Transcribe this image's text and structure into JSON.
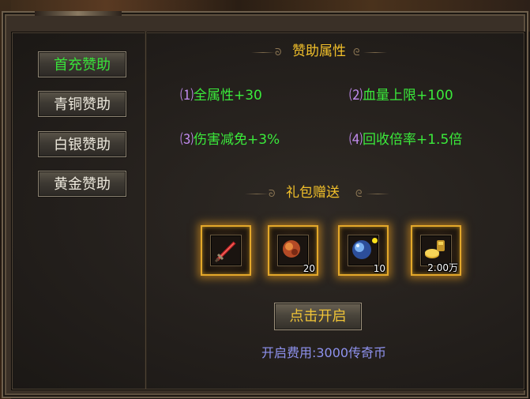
{
  "tabs": [
    {
      "label": "首充赞助",
      "active": true
    },
    {
      "label": "青铜赞助",
      "active": false
    },
    {
      "label": "白银赞助",
      "active": false
    },
    {
      "label": "黄金赞助",
      "active": false
    }
  ],
  "attributes_section": {
    "title": "赞助属性",
    "items": [
      {
        "index": "⑴",
        "text": "全属性+30"
      },
      {
        "index": "⑵",
        "text": "血量上限+100"
      },
      {
        "index": "⑶",
        "text": "伤害减免+3%"
      },
      {
        "index": "⑷",
        "text": "回收倍率+1.5倍"
      }
    ]
  },
  "gift_section": {
    "title": "礼包赠送",
    "items": [
      {
        "icon": "red-sword-icon",
        "count": ""
      },
      {
        "icon": "red-gem-icon",
        "count": "20"
      },
      {
        "icon": "blue-orb-icon",
        "count": "10"
      },
      {
        "icon": "gold-coins-icon",
        "count": "2.00万"
      }
    ]
  },
  "open_button": {
    "label": "点击开启"
  },
  "cost_text": "开启费用:3000传奇币",
  "colors": {
    "active_tab": "#39e23a",
    "title": "#f2c02a",
    "attr_index": "#c28cf0",
    "attr_text": "#3bea3b",
    "cost": "#8e92ee",
    "slot_glow": "#e4a82a"
  }
}
